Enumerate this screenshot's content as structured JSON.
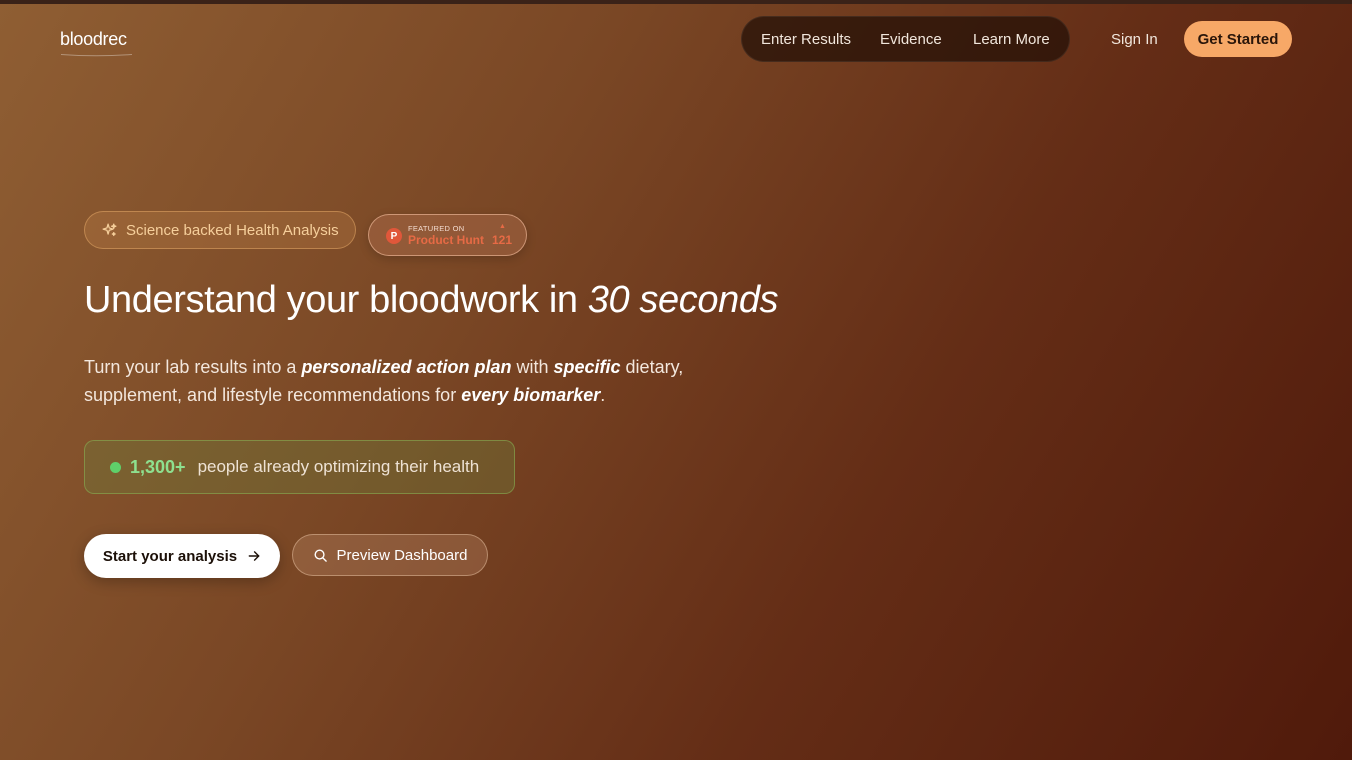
{
  "header": {
    "logo": "bloodrec",
    "nav": [
      "Enter Results",
      "Evidence",
      "Learn More"
    ],
    "sign_in": "Sign In",
    "get_started": "Get Started"
  },
  "hero": {
    "badge_science": "Science backed Health Analysis",
    "product_hunt": {
      "logo_letter": "P",
      "featured": "FEATURED ON",
      "name": "Product Hunt",
      "upvote_glyph": "▲",
      "count": "121"
    },
    "headline_main": "Understand your bloodwork in ",
    "headline_em": "30 seconds",
    "sub": {
      "p1": "Turn your lab results into a ",
      "e1": "personalized action plan",
      "p2": " with ",
      "e2": "specific",
      "p3": " dietary, supplement, and lifestyle recommendations for ",
      "e3": "every biomarker",
      "p4": "."
    },
    "proof_count": "1,300+",
    "proof_text": "people already optimizing their health",
    "cta_primary": "Start your analysis",
    "cta_secondary": "Preview Dashboard"
  },
  "colors": {
    "accent": "#f7a867",
    "proof_green": "#5fd06a",
    "product_hunt": "#e0573a"
  },
  "icons": [
    "sparkle-icon",
    "product-hunt-icon",
    "upvote-arrow-icon",
    "arrow-right-icon",
    "search-icon"
  ]
}
